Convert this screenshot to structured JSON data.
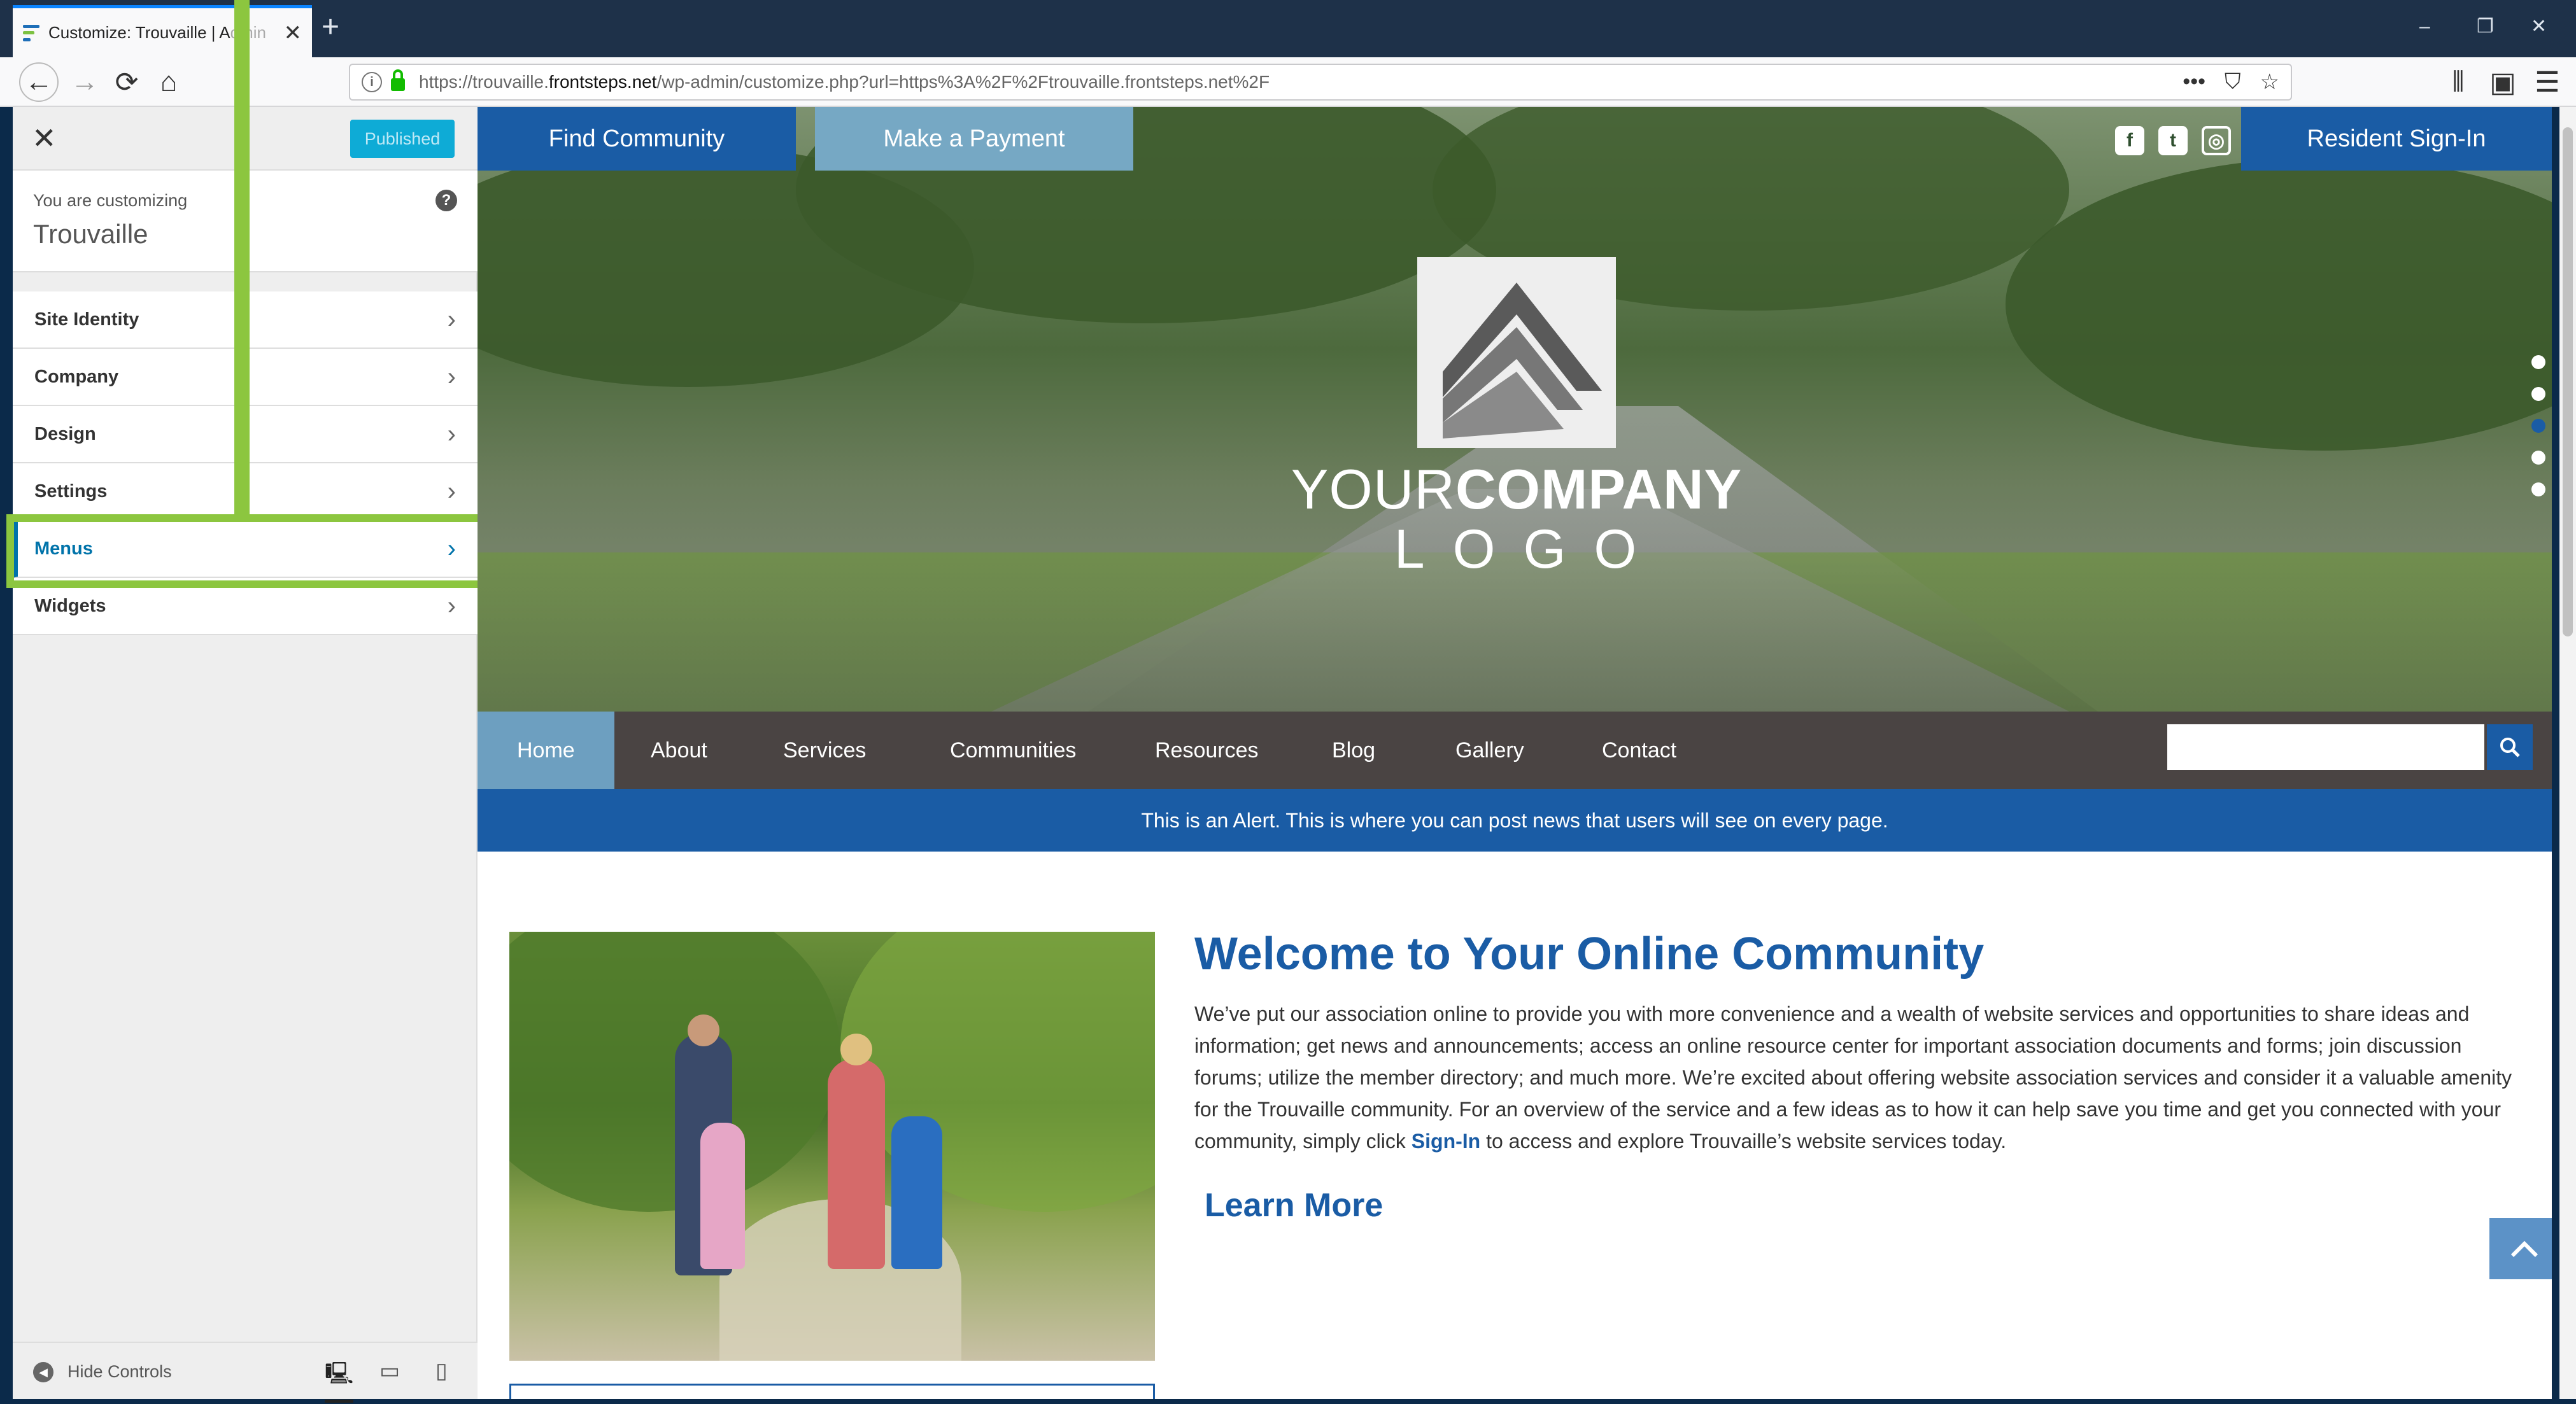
{
  "browser": {
    "tab_title": "Customize: Trouvaille | A",
    "tab_title_faded": "dmin",
    "tab_close": "✕",
    "new_tab": "+",
    "window_controls": [
      "–",
      "❐",
      "✕"
    ],
    "back": "←",
    "forward": "→",
    "reload": "⟳",
    "home": "⌂",
    "url_prefix": "https://trouvaille.",
    "url_host": "frontsteps.net",
    "url_path": "/wp-admin/customize.php?url=https%3A%2F%2Ftrouvaille.frontsteps.net%2F",
    "url_actions": [
      "•••",
      "⛉",
      "☆"
    ],
    "toolbar_icons": [
      "⫴",
      "▣",
      "☰"
    ]
  },
  "customizer": {
    "close": "✕",
    "publish_label": "Published",
    "customizing_label": "You are customizing",
    "site_name": "Trouvaille",
    "help": "?",
    "sections": [
      {
        "label": "Site Identity",
        "chev": "›"
      },
      {
        "label": "Company",
        "chev": "›"
      },
      {
        "label": "Design",
        "chev": "›"
      },
      {
        "label": "Settings",
        "chev": "›"
      },
      {
        "label": "Menus",
        "chev": "›",
        "active": true
      },
      {
        "label": "Widgets",
        "chev": "›"
      }
    ],
    "hide_icon": "◀",
    "hide_controls": "Hide Controls",
    "devices": [
      "🖳",
      "▭",
      "▯"
    ]
  },
  "site": {
    "find_community": "Find Community",
    "make_payment": "Make a Payment",
    "social": [
      "f",
      "t",
      "◎"
    ],
    "resident_signin": "Resident Sign-In",
    "logo_line1": "YOURCOMPANY",
    "logo_line1_light": "YOUR",
    "logo_line1_bold": "COMPANY",
    "logo_line2": "LOGO",
    "nav": [
      "Home",
      "About",
      "Services",
      "Communities",
      "Resources",
      "Blog",
      "Gallery",
      "Contact"
    ],
    "search_placeholder": "",
    "search_icon": "⌕",
    "alert": "This is an Alert. This is where you can post news that users will see on every page.",
    "welcome_title": "Welcome to Your Online Community",
    "body_before": "We’ve put our association online to provide you with more convenience and a wealth of website services and opportunities to share ideas and information; get news and announcements; access an online resource center for important association documents and forms; join discussion forums; utilize the member directory; and much more. We’re excited about offering website association services and consider it a valuable amenity for the Trouvaille community. For an overview of the service and a few ideas as to how it can help save you time and get you connected with your community, simply click ",
    "body_link": "Sign-In",
    "body_after": " to access and explore Trouvaille’s website services today.",
    "learn_more": "Learn More",
    "back_to_top": "⌃"
  },
  "colors": {
    "brand_blue": "#1a5ca5",
    "nav_active": "#6d9fc0",
    "payment_btn": "#76a8c4",
    "annotation_green": "#8cc63f",
    "wp_blue": "#0073aa"
  }
}
